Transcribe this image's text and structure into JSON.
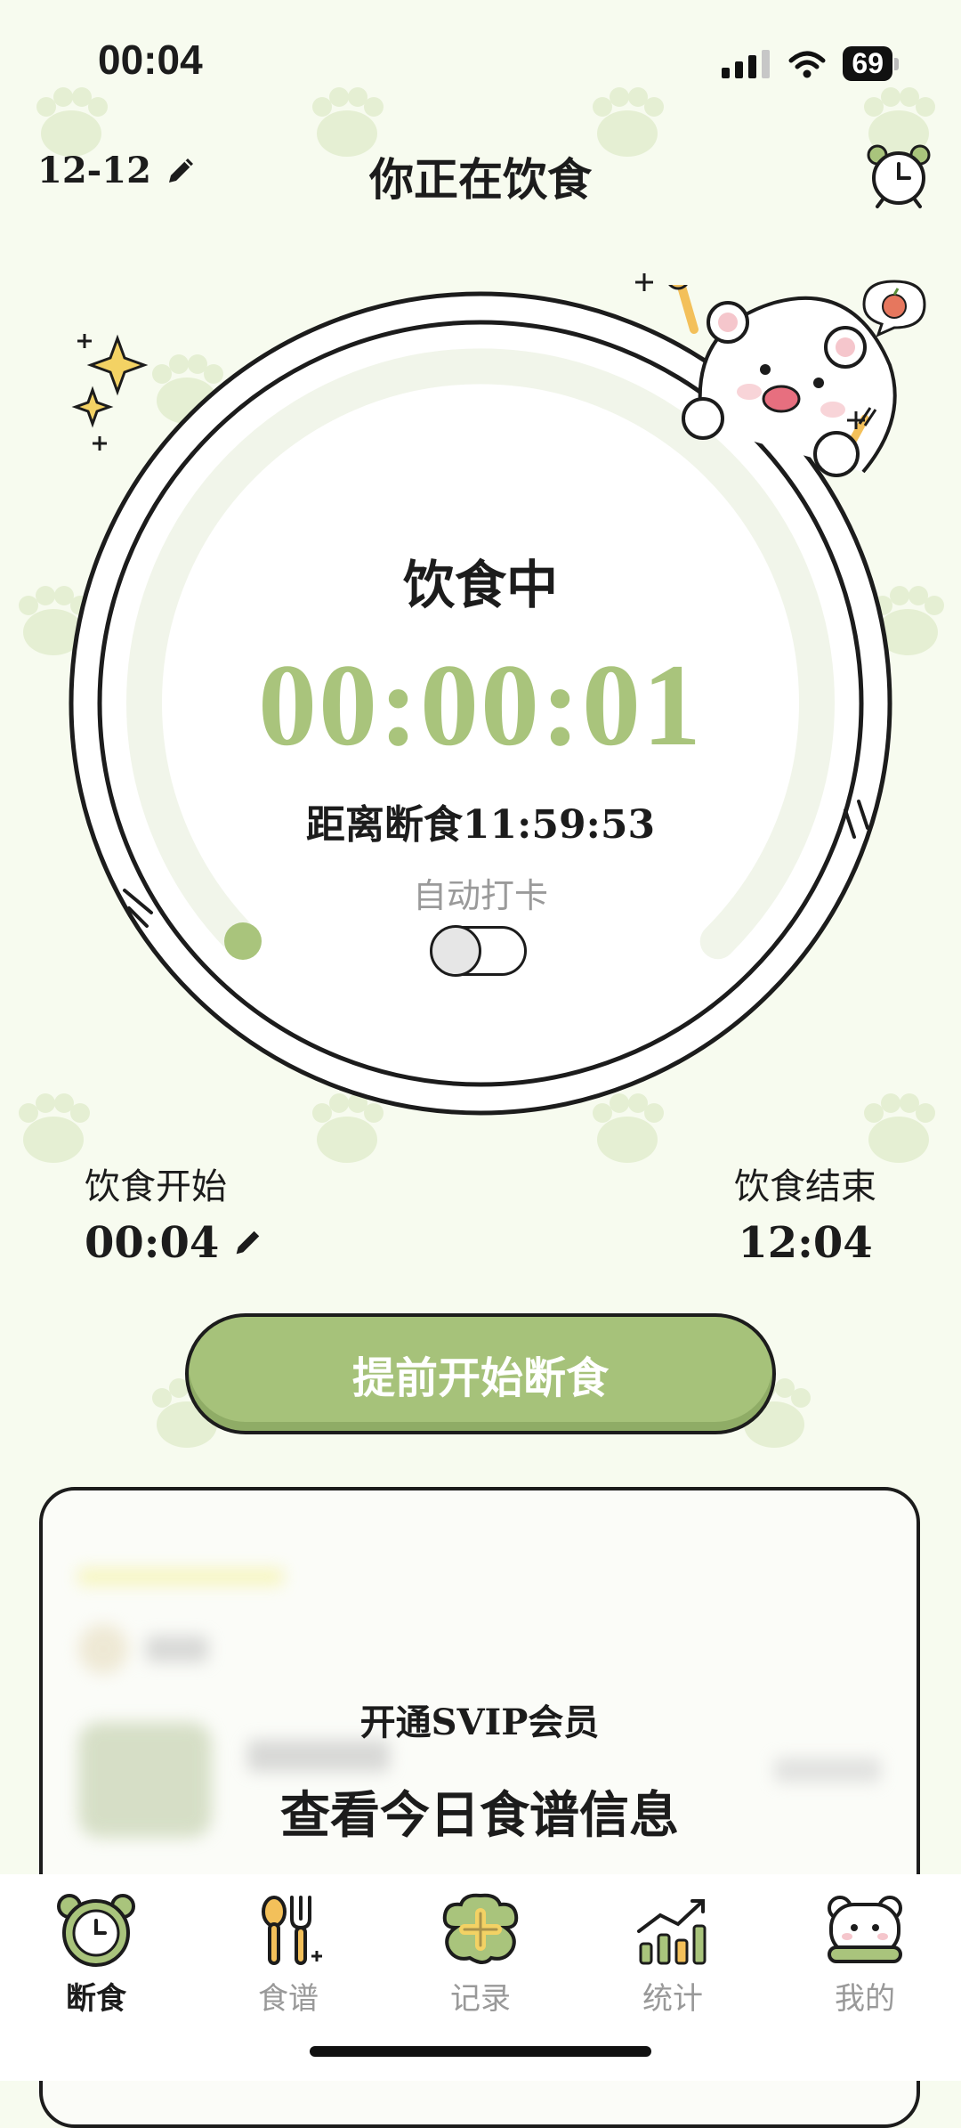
{
  "status_bar": {
    "time": "00:04",
    "battery": "69"
  },
  "header": {
    "date": "12-12",
    "title": "你正在饮食"
  },
  "dial": {
    "state": "饮食中",
    "elapsed": "00:00:01",
    "countdown": "距离断食11:59:53",
    "auto_checkin_label": "自动打卡",
    "auto_checkin_on": false
  },
  "schedule": {
    "start_label": "饮食开始",
    "start_time": "00:04",
    "end_label": "饮食结束",
    "end_time": "12:04"
  },
  "cta_label": "提前开始断食",
  "recipe_card": {
    "locked_line1": "开通SVIP会员",
    "locked_line2": "查看今日食谱信息"
  },
  "tabs": [
    {
      "label": "断食",
      "icon": "clock-bear-icon",
      "active": true
    },
    {
      "label": "食谱",
      "icon": "utensils-icon",
      "active": false
    },
    {
      "label": "记录",
      "icon": "add-record-icon",
      "active": false
    },
    {
      "label": "统计",
      "icon": "stats-chart-icon",
      "active": false
    },
    {
      "label": "我的",
      "icon": "bear-profile-icon",
      "active": false
    }
  ],
  "colors": {
    "accent": "#a9c47c",
    "background": "#f7fbef",
    "ink": "#1c1c1c"
  }
}
